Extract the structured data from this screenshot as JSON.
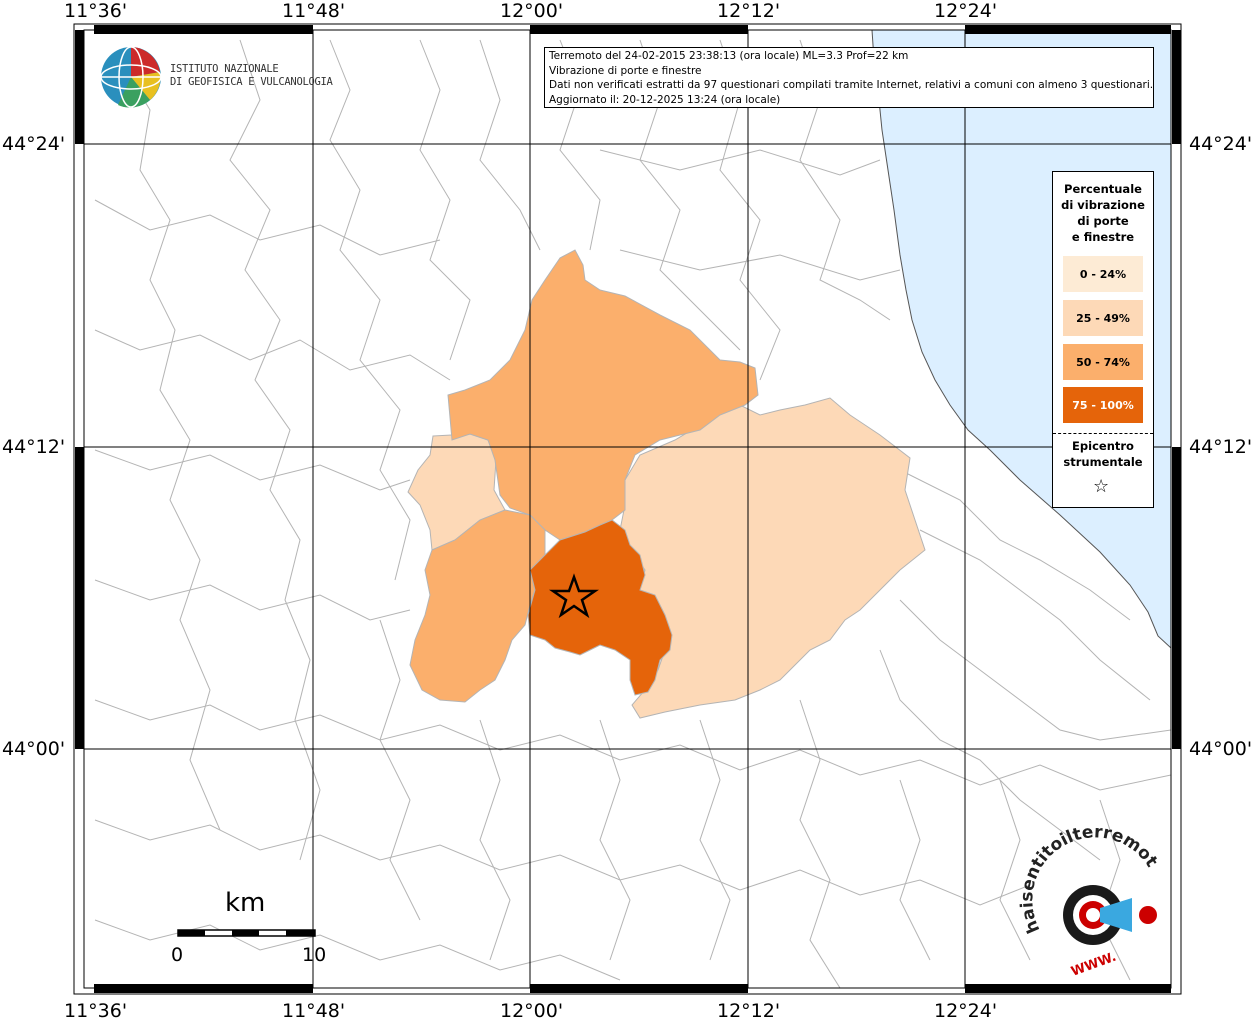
{
  "info": {
    "line1": "Terremoto del 24-02-2015 23:38:13 (ora locale) ML=3.3 Prof=22 km",
    "line2": "Vibrazione di porte e finestre",
    "line3": "Dati non verificati estratti da 97 questionari compilati tramite Internet, relativi a comuni con almeno 3 questionari.",
    "line4": "Aggiornato il: 20-12-2025 13:24 (ora locale)"
  },
  "logo": {
    "line1": "ISTITUTO NAZIONALE",
    "line2": "DI GEOFISICA E VULCANOLOGIA"
  },
  "legend": {
    "title": [
      "Percentuale",
      "di vibrazione",
      "di porte",
      "e finestre"
    ],
    "classes": [
      {
        "label": "0 - 24%",
        "color": "#fdebd5"
      },
      {
        "label": "25 - 49%",
        "color": "#fdd9b7"
      },
      {
        "label": "50 - 74%",
        "color": "#fbaf6c"
      },
      {
        "label": "75 - 100%",
        "color": "#e5640a"
      }
    ],
    "epicenter": [
      "Epicentro",
      "strumentale"
    ]
  },
  "axes": {
    "lon_labels": [
      "11°36'",
      "11°48'",
      "12°00'",
      "12°12'",
      "12°24'"
    ],
    "lat_labels": [
      "44°24'",
      "44°12'",
      "44°00'"
    ]
  },
  "scale": {
    "unit": "km",
    "min": "0",
    "max": "10"
  },
  "watermark": {
    "text": "haisentitoilterremoto.it",
    "sub": "WWW."
  },
  "colors": {
    "sea": "#dcefff",
    "grid": "#000000",
    "borders": "#b4b4b4"
  }
}
